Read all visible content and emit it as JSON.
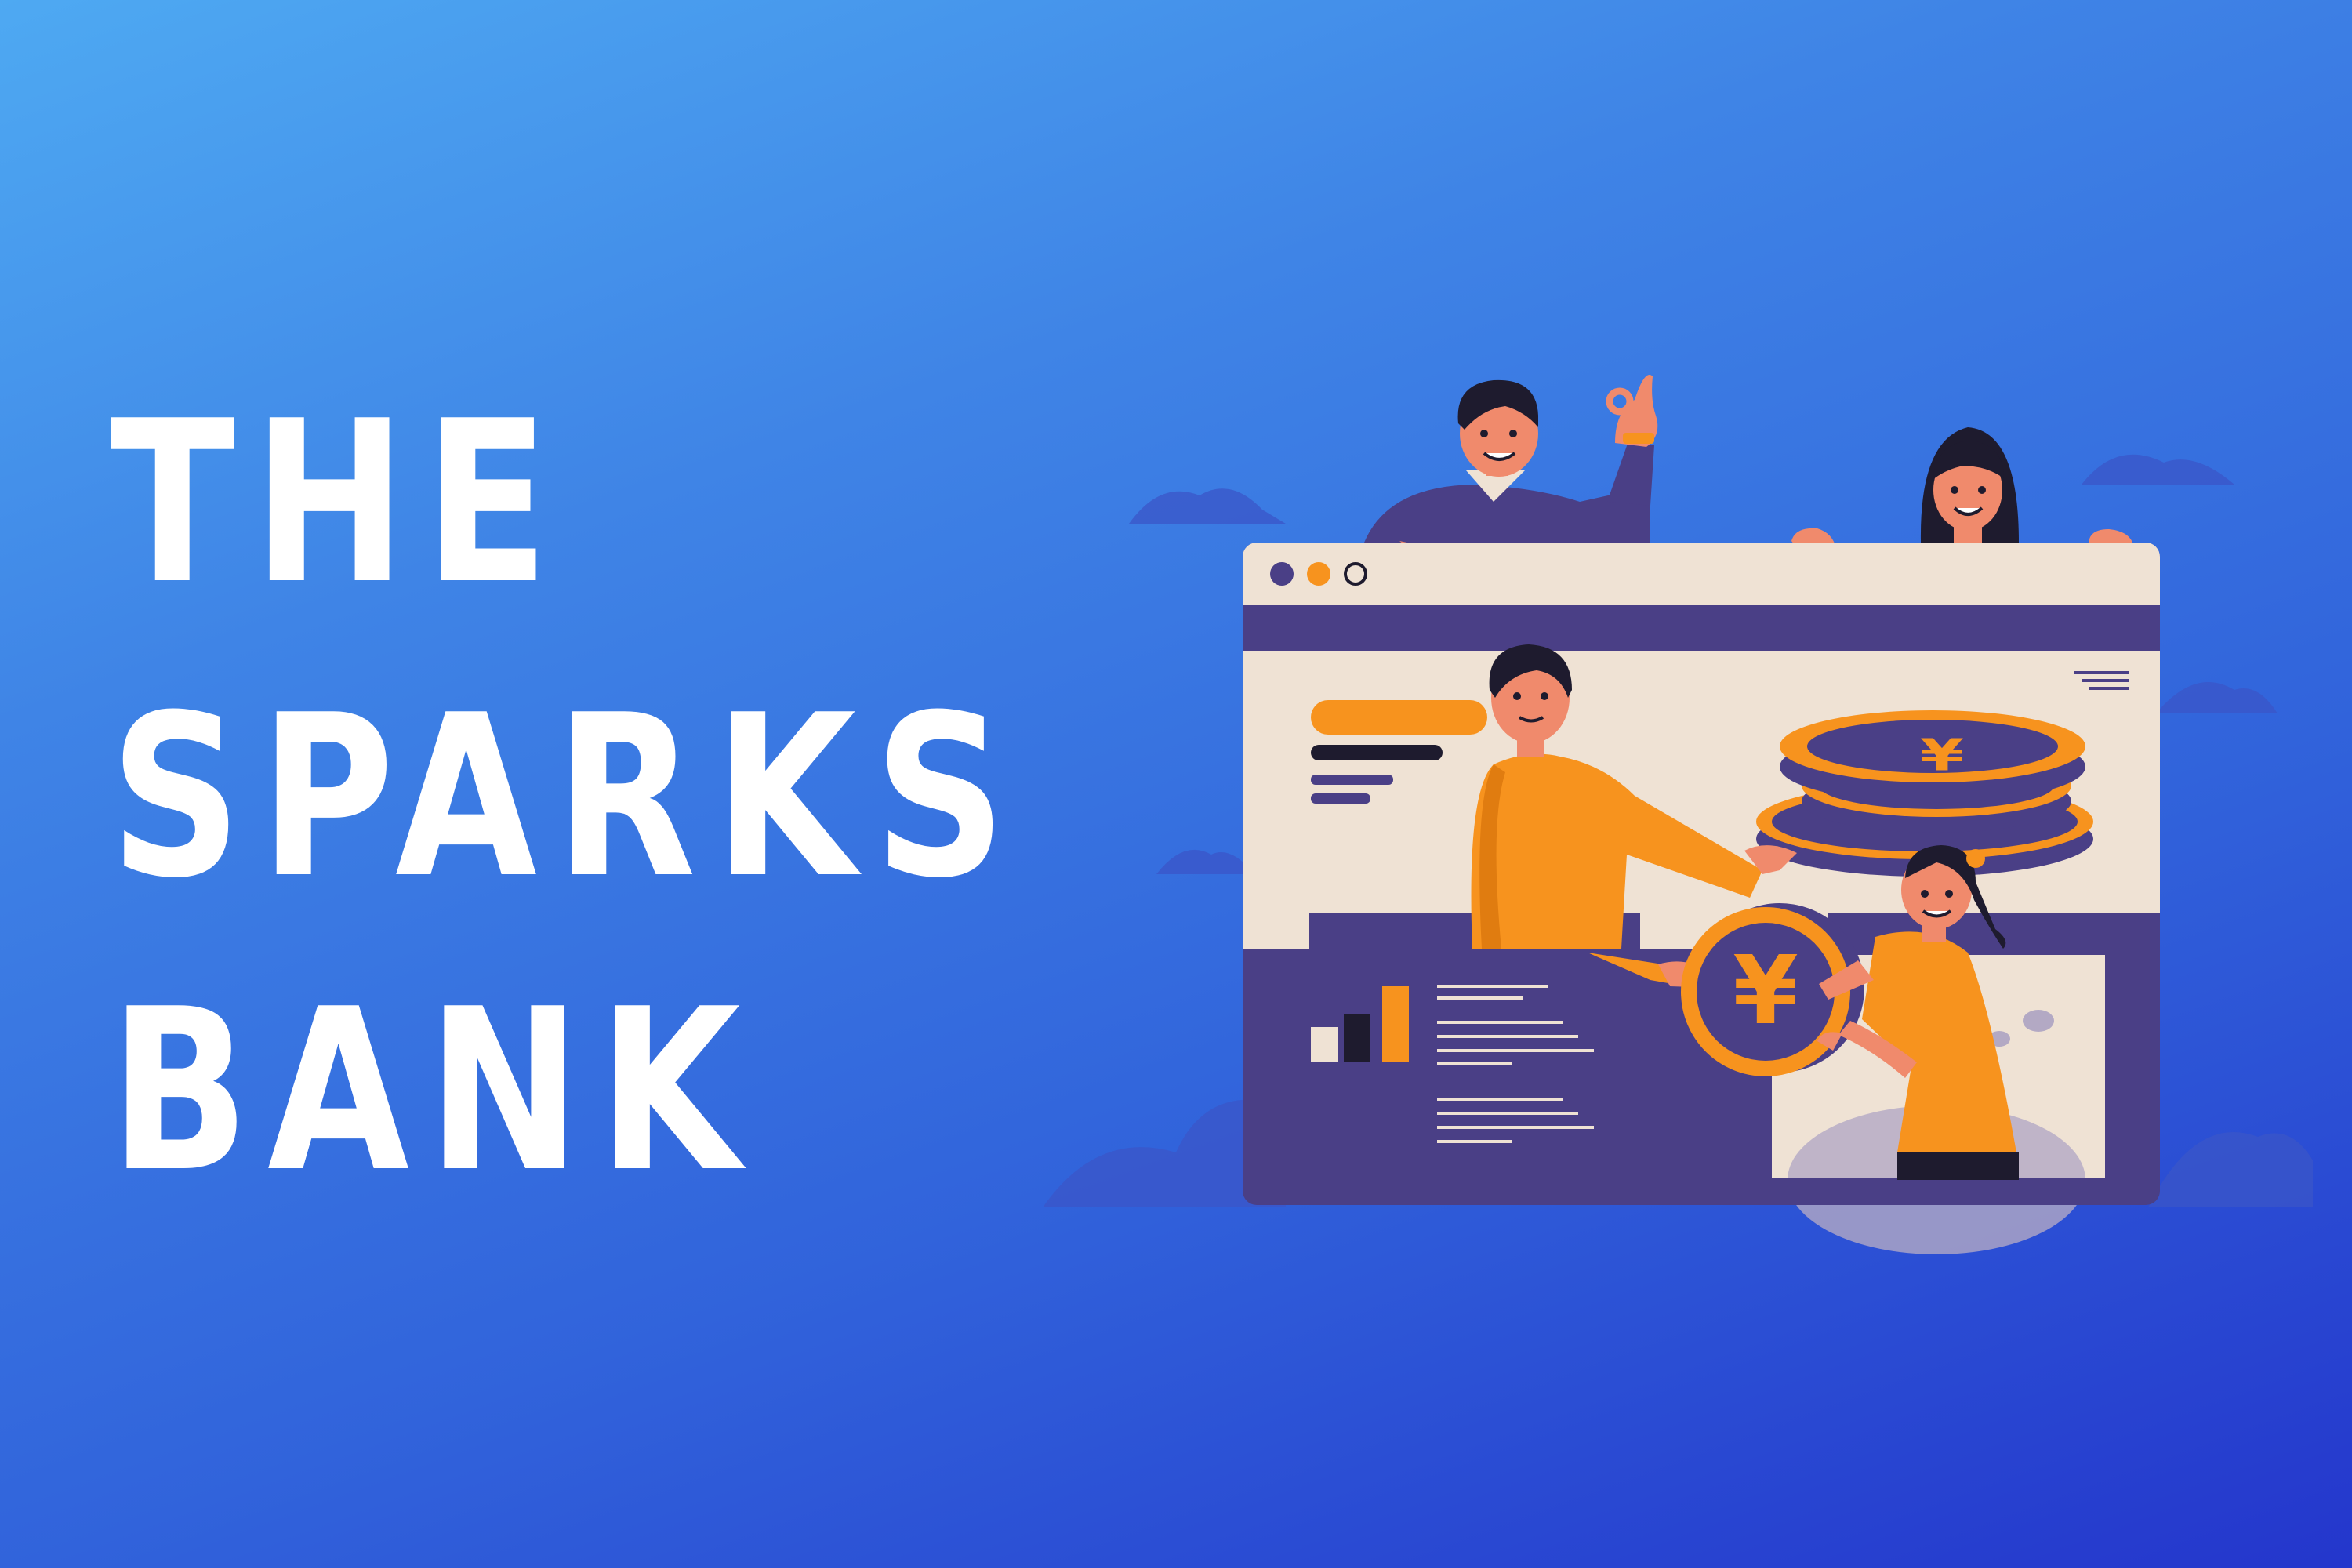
{
  "headline": {
    "line1": "THE",
    "line2": "SPARKS",
    "line3": "BANK"
  },
  "illustration": {
    "currency_symbol": "¥",
    "chart_bar_values": [
      0.35,
      0.55,
      0.85
    ]
  },
  "colors": {
    "background_top": "#4EA9F2",
    "background_bottom": "#2436CC",
    "accent_orange": "#F7931E",
    "navy": "#4A3F86",
    "cream": "#EFE2D4"
  }
}
